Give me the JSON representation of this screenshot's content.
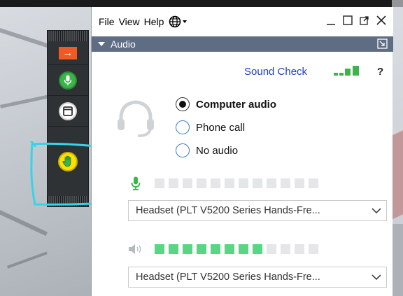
{
  "menubar": {
    "file": "File",
    "view": "View",
    "help": "Help"
  },
  "audio_section": {
    "title": "Audio",
    "sound_check": "Sound Check",
    "help_symbol": "?",
    "options": [
      {
        "label": "Computer audio",
        "selected": true
      },
      {
        "label": "Phone call",
        "selected": false
      },
      {
        "label": "No audio",
        "selected": false
      }
    ],
    "microphone": {
      "level_segments_total": 12,
      "level_segments_active": 0,
      "device": "Headset (PLT V5200 Series Hands-Fre..."
    },
    "speaker": {
      "level_segments_total": 12,
      "level_segments_active": 8,
      "device": "Headset (PLT V5200 Series Hands-Fre..."
    }
  },
  "side_toolbar": {
    "buttons": [
      "collapse-arrow",
      "microphone",
      "window",
      "raise-hand"
    ]
  },
  "colors": {
    "header_bar": "#5e6d84",
    "accent_blue": "#1e3fc6",
    "meter_active": "#58d683",
    "meter_inactive": "#e4e6e8",
    "toolbar_bg": "#2f3235",
    "arrow_orange": "#f15a22",
    "mic_green": "#3bb54a",
    "raise_hand_yellow": "#ffe000",
    "annotation_cyan": "#36d4e6"
  }
}
